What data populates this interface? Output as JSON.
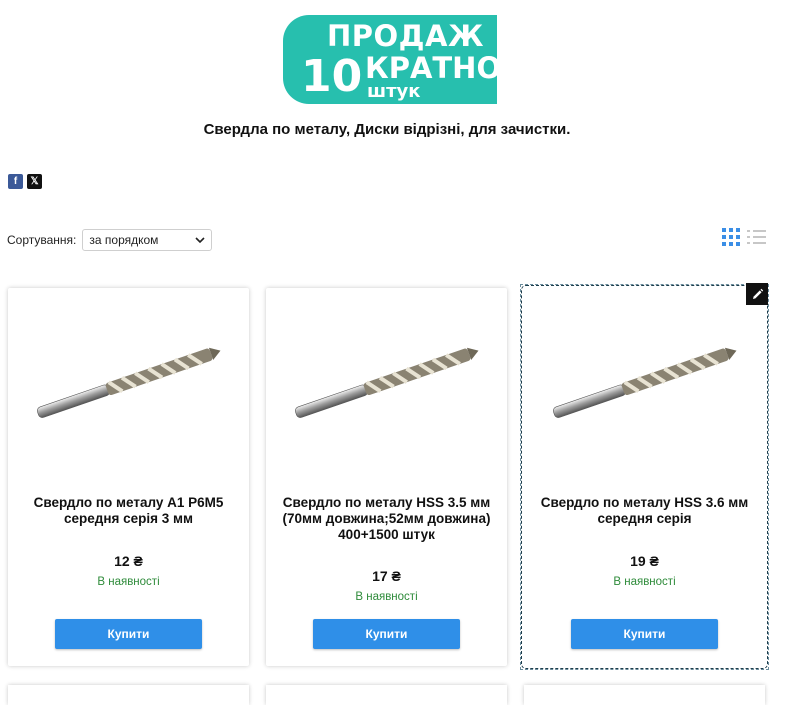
{
  "banner": {
    "line1": "ПРОДАЖ",
    "number": "10",
    "line2": "КРАТНО",
    "line3": "штук",
    "color": "#27bfae"
  },
  "category_subtitle": "Свердла по металу, Диски відрізні, для зачистки.",
  "social": {
    "facebook": "f",
    "x": "𝕏"
  },
  "sort": {
    "label": "Сортування:",
    "selected": "за порядком"
  },
  "view_modes": [
    "grid-view-icon",
    "list-view-icon"
  ],
  "accent_color": "#2f8fe8",
  "stock_color": "#2e8b3a",
  "products": [
    {
      "name": "Свердло по металу A1 P6M5 середня серія 3 мм",
      "price": "12 ₴",
      "stock": "В наявності",
      "buy": "Купити"
    },
    {
      "name": "Свердло по металу HSS 3.5 мм (70мм довжина;52мм довжина) 400+1500 штук",
      "price": "17 ₴",
      "stock": "В наявності",
      "buy": "Купити"
    },
    {
      "name": "Свердло по металу HSS 3.6 мм середня серія",
      "price": "19 ₴",
      "stock": "В наявності",
      "buy": "Купити"
    }
  ]
}
